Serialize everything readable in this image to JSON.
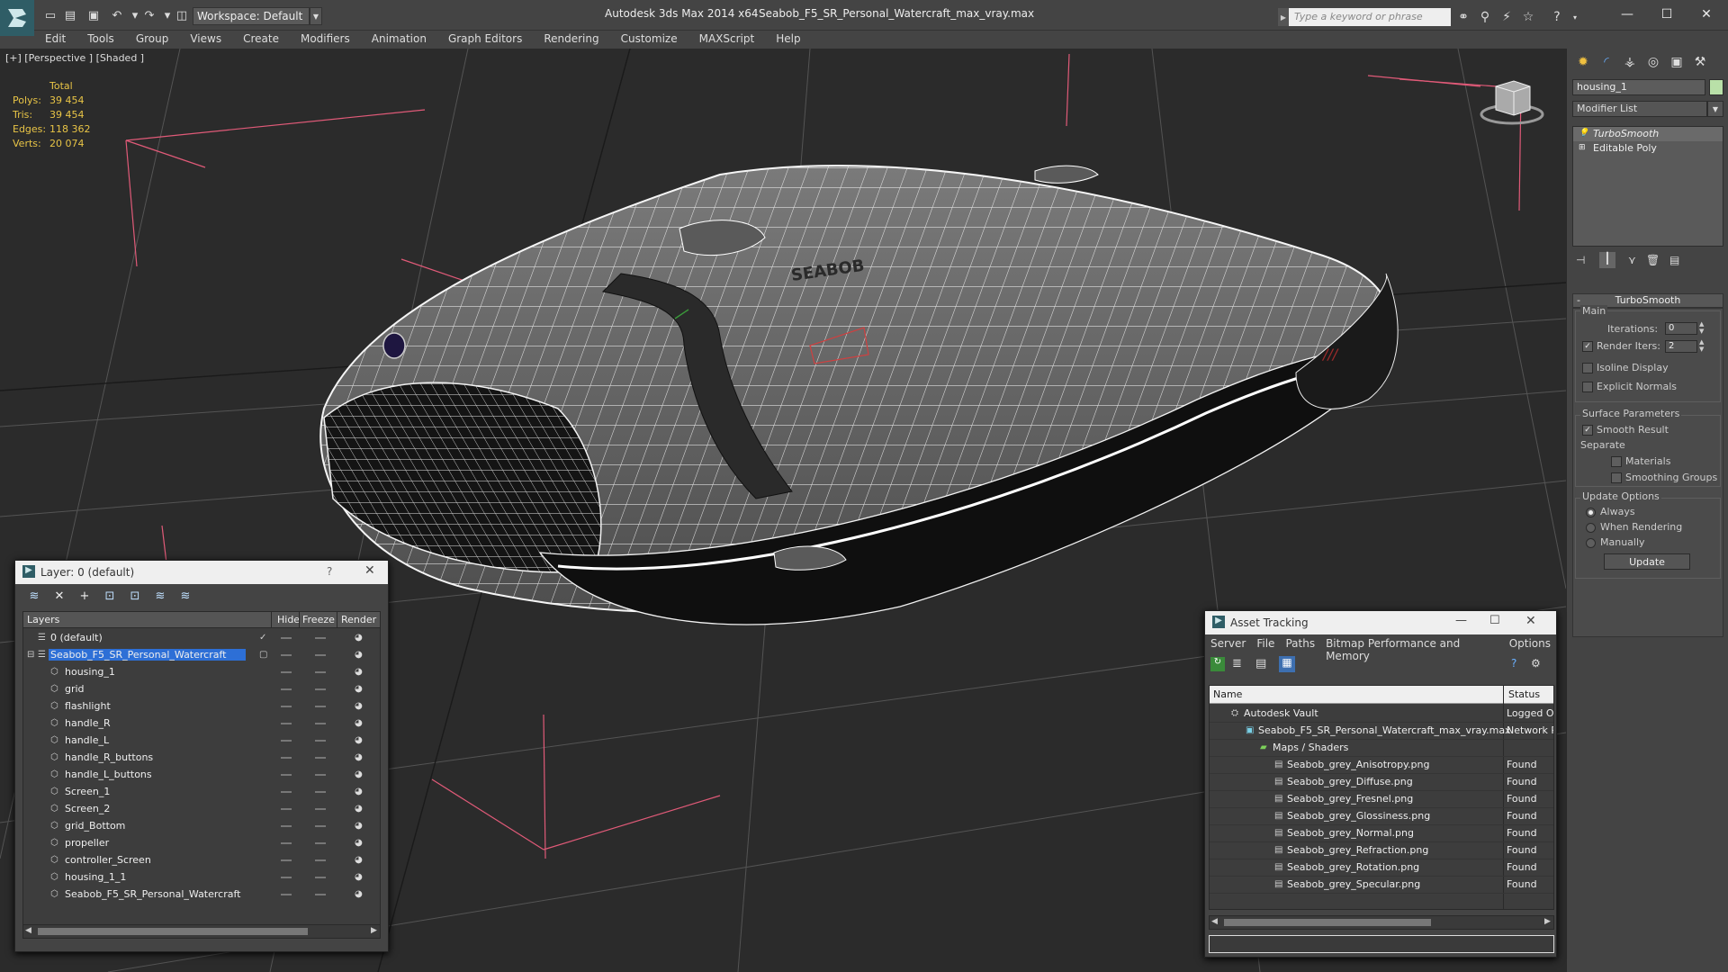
{
  "app": {
    "title": "Autodesk 3ds Max  2014 x64",
    "file": "Seabob_F5_SR_Personal_Watercraft_max_vray.max",
    "workspace": "Workspace: Default",
    "search_placeholder": "Type a keyword or phrase"
  },
  "menu": [
    "Edit",
    "Tools",
    "Group",
    "Views",
    "Create",
    "Modifiers",
    "Animation",
    "Graph Editors",
    "Rendering",
    "Customize",
    "MAXScript",
    "Help"
  ],
  "viewport": {
    "label": "[+] [Perspective ] [Shaded ]",
    "stats": {
      "header": "Total",
      "rows": [
        {
          "k": "Polys:",
          "v": "39 454"
        },
        {
          "k": "Tris:",
          "v": "39 454"
        },
        {
          "k": "Edges:",
          "v": "118 362"
        },
        {
          "k": "Verts:",
          "v": "20 074"
        }
      ]
    },
    "model_label": "SEABOB"
  },
  "command_panel": {
    "object_name": "housing_1",
    "object_color": "#b9e0a8",
    "modifier_list": "Modifier List",
    "stack": [
      "TurboSmooth",
      "Editable Poly"
    ],
    "rollout_title": "TurboSmooth",
    "main_label": "Main",
    "iterations_label": "Iterations:",
    "iterations_value": "0",
    "render_iters_label": "Render Iters:",
    "render_iters_value": "2",
    "isoline": "Isoline Display",
    "explicit_normals": "Explicit Normals",
    "surface_params": "Surface Parameters",
    "smooth_result": "Smooth Result",
    "separate": "Separate",
    "materials": "Materials",
    "smoothing_groups": "Smoothing Groups",
    "update_options": "Update Options",
    "always": "Always",
    "when_rendering": "When Rendering",
    "manually": "Manually",
    "update_button": "Update"
  },
  "layer_window": {
    "title": "Layer: 0 (default)",
    "help": "?",
    "columns": [
      "Layers",
      "Hide",
      "Freeze",
      "Render"
    ],
    "rows": [
      {
        "name": "0 (default)",
        "level": 0,
        "current": true
      },
      {
        "name": "Seabob_F5_SR_Personal_Watercraft",
        "level": 0,
        "selected": true
      },
      {
        "name": "housing_1",
        "level": 1
      },
      {
        "name": "grid",
        "level": 1
      },
      {
        "name": "flashlight",
        "level": 1
      },
      {
        "name": "handle_R",
        "level": 1
      },
      {
        "name": "handle_L",
        "level": 1
      },
      {
        "name": "handle_R_buttons",
        "level": 1
      },
      {
        "name": "handle_L_buttons",
        "level": 1
      },
      {
        "name": "Screen_1",
        "level": 1
      },
      {
        "name": "Screen_2",
        "level": 1
      },
      {
        "name": "grid_Bottom",
        "level": 1
      },
      {
        "name": "propeller",
        "level": 1
      },
      {
        "name": "controller_Screen",
        "level": 1
      },
      {
        "name": "housing_1_1",
        "level": 1
      },
      {
        "name": "Seabob_F5_SR_Personal_Watercraft",
        "level": 1
      }
    ]
  },
  "asset_window": {
    "title": "Asset Tracking",
    "menu": [
      "Server",
      "File",
      "Paths",
      "Bitmap Performance and Memory",
      "Options"
    ],
    "columns": [
      "Name",
      "Status"
    ],
    "rows": [
      {
        "name": "Autodesk Vault",
        "status": "Logged O",
        "level": 0
      },
      {
        "name": "Seabob_F5_SR_Personal_Watercraft_max_vray.max",
        "status": "Network P",
        "level": 1
      },
      {
        "name": "Maps / Shaders",
        "status": "",
        "level": 2
      },
      {
        "name": "Seabob_grey_Anisotropy.png",
        "status": "Found",
        "level": 3
      },
      {
        "name": "Seabob_grey_Diffuse.png",
        "status": "Found",
        "level": 3
      },
      {
        "name": "Seabob_grey_Fresnel.png",
        "status": "Found",
        "level": 3
      },
      {
        "name": "Seabob_grey_Glossiness.png",
        "status": "Found",
        "level": 3
      },
      {
        "name": "Seabob_grey_Normal.png",
        "status": "Found",
        "level": 3
      },
      {
        "name": "Seabob_grey_Refraction.png",
        "status": "Found",
        "level": 3
      },
      {
        "name": "Seabob_grey_Rotation.png",
        "status": "Found",
        "level": 3
      },
      {
        "name": "Seabob_grey_Specular.png",
        "status": "Found",
        "level": 3
      }
    ]
  },
  "colors": {
    "selection": "#2d6fd6",
    "stat_text": "#e8c446",
    "grid_line": "#5a5a5a",
    "bbox_line": "#e05a78"
  }
}
